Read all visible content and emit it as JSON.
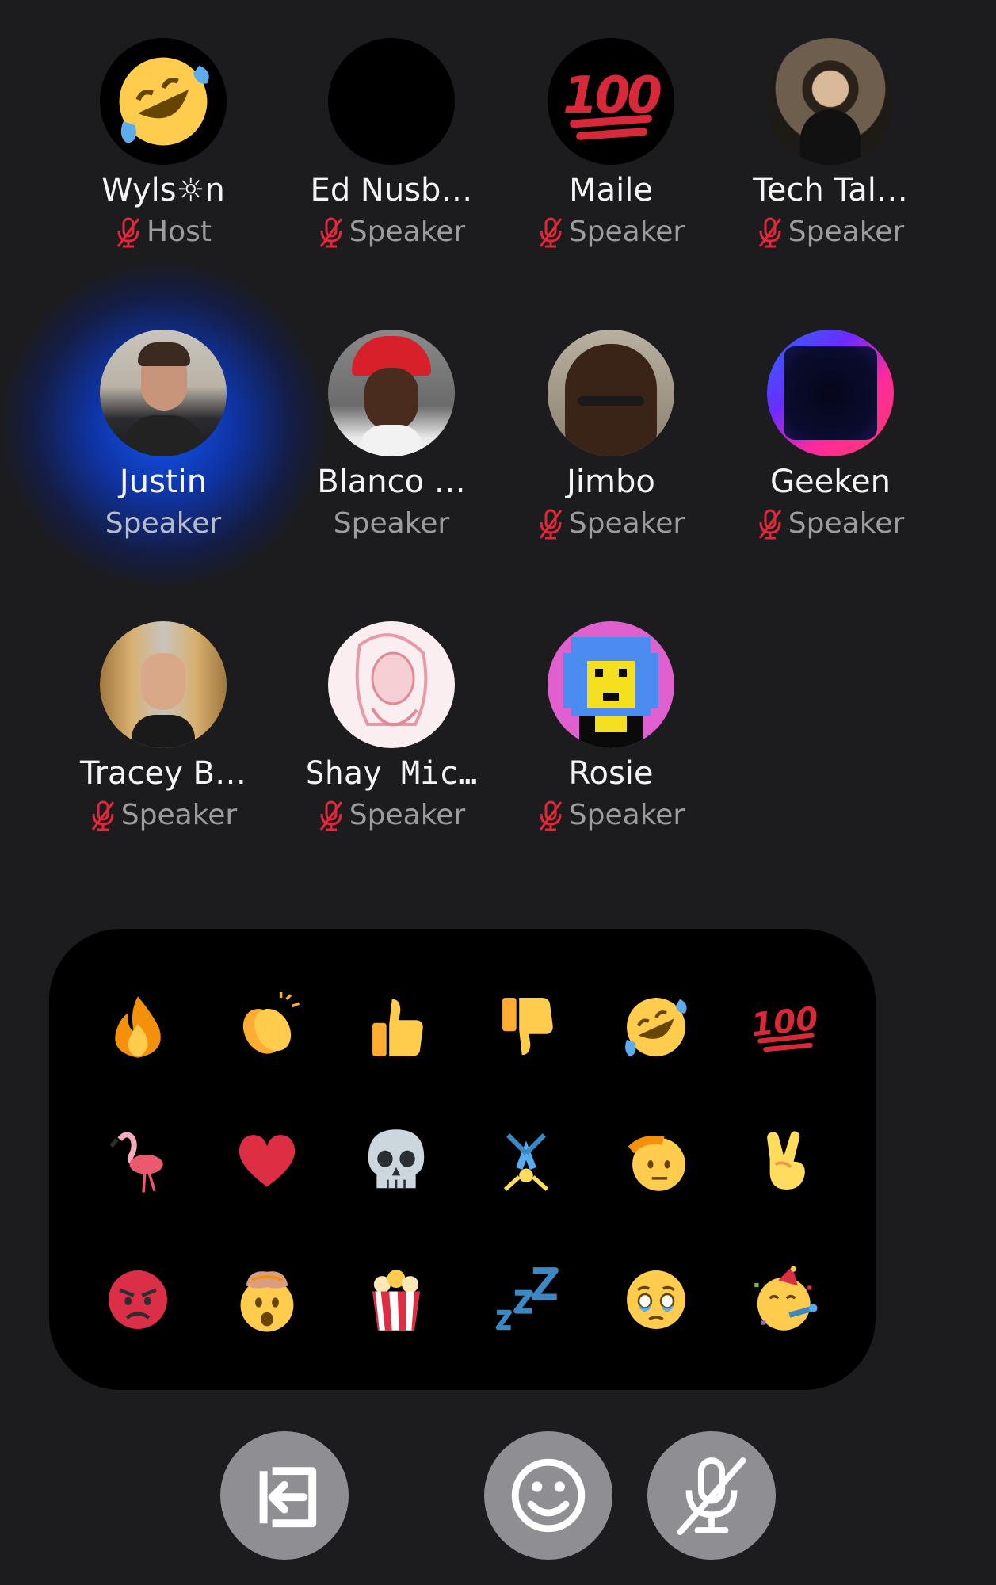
{
  "speakers": [
    {
      "name": "Wyls☼n",
      "role": "Host",
      "muted": true,
      "avatar": "rofl-emoji-avatar"
    },
    {
      "name": "Ed Nusb…",
      "role": "Speaker",
      "muted": true,
      "avatar": "blank-black-avatar"
    },
    {
      "name": "Maile",
      "role": "Speaker",
      "muted": true,
      "avatar": "hundred-emoji-avatar"
    },
    {
      "name": "Tech Tal…",
      "role": "Speaker",
      "muted": true,
      "avatar": "photo-man-at-conference"
    },
    {
      "name": "Justin",
      "role": "Speaker",
      "muted": false,
      "speaking": true,
      "avatar": "photo-man-in-suit"
    },
    {
      "name": "Blanco …",
      "role": "Speaker",
      "muted": false,
      "avatar": "photo-woman-red-cap"
    },
    {
      "name": "Jimbo",
      "role": "Speaker",
      "muted": true,
      "avatar": "photo-man-glasses-selfie"
    },
    {
      "name": "Geeken",
      "role": "Speaker",
      "muted": true,
      "avatar": "neon-led-frame"
    },
    {
      "name": "Tracey B…",
      "role": "Speaker",
      "muted": true,
      "avatar": "photo-woman-blonde"
    },
    {
      "name": "Shay Mic…",
      "role": "Speaker",
      "muted": true,
      "avatar": "pink-sketch-woman"
    },
    {
      "name": "Rosie",
      "role": "Speaker",
      "muted": true,
      "avatar": "pixel-art-girl"
    }
  ],
  "reactions": [
    [
      "fire-icon",
      "clapping-hands-icon",
      "thumbs-up-icon",
      "thumbs-down-icon",
      "rofl-icon",
      "hundred-icon"
    ],
    [
      "flamingo-icon",
      "red-heart-icon",
      "skull-icon",
      "cartwheel-icon",
      "saluting-face-icon",
      "victory-hand-icon"
    ],
    [
      "angry-face-icon",
      "exploding-head-icon",
      "popcorn-icon",
      "zzz-icon",
      "holding-back-tears-icon",
      "partying-face-icon"
    ]
  ],
  "reaction_texts": {
    "hundred": "100"
  },
  "controls": [
    "leave-button",
    "reactions-button",
    "mic-toggle-button"
  ],
  "colors": {
    "background": "#1c1c1e",
    "panel": "#000000",
    "muted_red": "#e0283a",
    "speaking_glow": "#1e5bff",
    "control_button": "#8e8e93"
  }
}
